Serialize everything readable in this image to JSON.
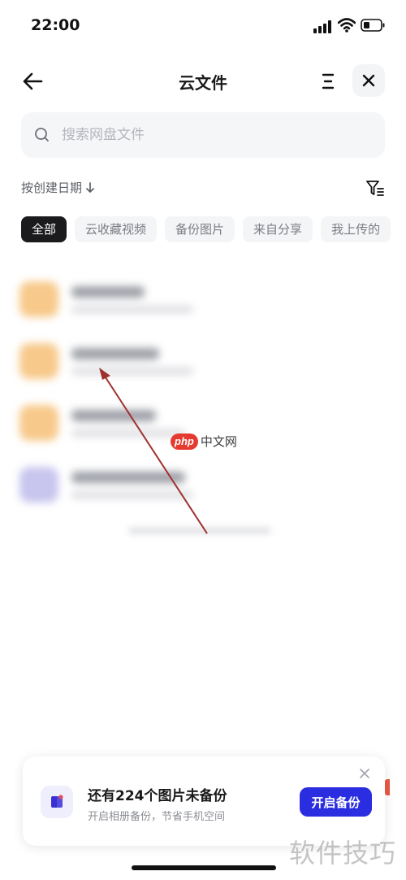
{
  "status_bar": {
    "time": "22:00"
  },
  "nav": {
    "title": "云文件"
  },
  "search": {
    "placeholder": "搜索网盘文件"
  },
  "sort": {
    "label": "按创建日期"
  },
  "tabs": [
    {
      "label": "全部",
      "active": true
    },
    {
      "label": "云收藏视频",
      "active": false
    },
    {
      "label": "备份图片",
      "active": false
    },
    {
      "label": "来自分享",
      "active": false
    },
    {
      "label": "我上传的",
      "active": false
    }
  ],
  "watermarks": {
    "badge": "php",
    "site": "中文网",
    "corner": "软件技巧"
  },
  "backup_card": {
    "title": "还有224个图片未备份",
    "subtitle": "开启相册备份，节省手机空间",
    "button": "开启备份"
  },
  "colors": {
    "accent": "#2b2de0",
    "active_tab": "#1b1b1d",
    "folder": "#f7c98a",
    "annotation_arrow": "#a03030"
  }
}
